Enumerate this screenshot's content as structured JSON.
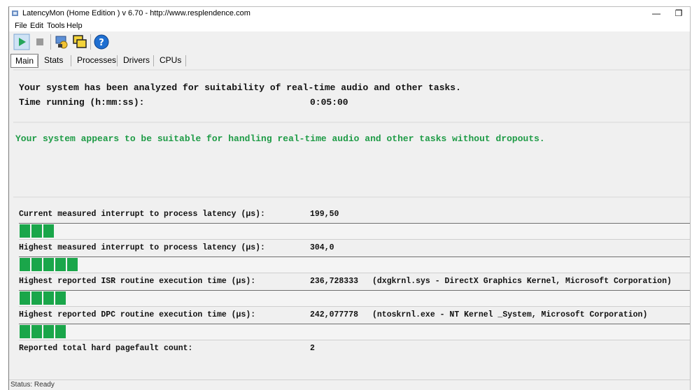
{
  "window": {
    "title": "LatencyMon  (Home Edition )  v 6.70 - http://www.resplendence.com",
    "minimize_glyph": "—",
    "restore_glyph": "❐"
  },
  "menu": [
    "File",
    "Edit",
    "Tools",
    "Help"
  ],
  "toolbar": {
    "buttons": [
      "play-icon",
      "stop-icon",
      "process-icon",
      "windows-icon",
      "help-icon"
    ]
  },
  "tabs": [
    "Main",
    "Stats",
    "Processes",
    "Drivers",
    "CPUs"
  ],
  "summary": {
    "line1": "Your system has been analyzed for suitability of real-time audio and other tasks.",
    "time_label": "Time running (h:mm:ss):",
    "time_value": "0:05:00"
  },
  "verdict": {
    "text": "Your system appears to be suitable for handling real-time audio and other tasks without dropouts.",
    "color": "#1e9b46"
  },
  "metrics": [
    {
      "label": "Current measured interrupt to process latency (µs):",
      "value": "199,50",
      "detail": "",
      "segments": 3
    },
    {
      "label": "Highest measured interrupt to process latency (µs):",
      "value": "304,0",
      "detail": "",
      "segments": 5
    },
    {
      "label": "Highest reported ISR routine execution time (µs):",
      "value": "236,728333",
      "detail": "(dxgkrnl.sys - DirectX Graphics Kernel, Microsoft Corporation)",
      "segments": 4
    },
    {
      "label": "Highest reported DPC routine execution time (µs):",
      "value": "242,077778",
      "detail": "(ntoskrnl.exe - NT Kernel _System, Microsoft Corporation)",
      "segments": 4
    }
  ],
  "pagefault": {
    "label": "Reported total hard pagefault count:",
    "value": "2"
  },
  "status": "Status: Ready",
  "colors": {
    "bar_green": "#1aa64a",
    "accent_blue": "#1f6fd1"
  }
}
